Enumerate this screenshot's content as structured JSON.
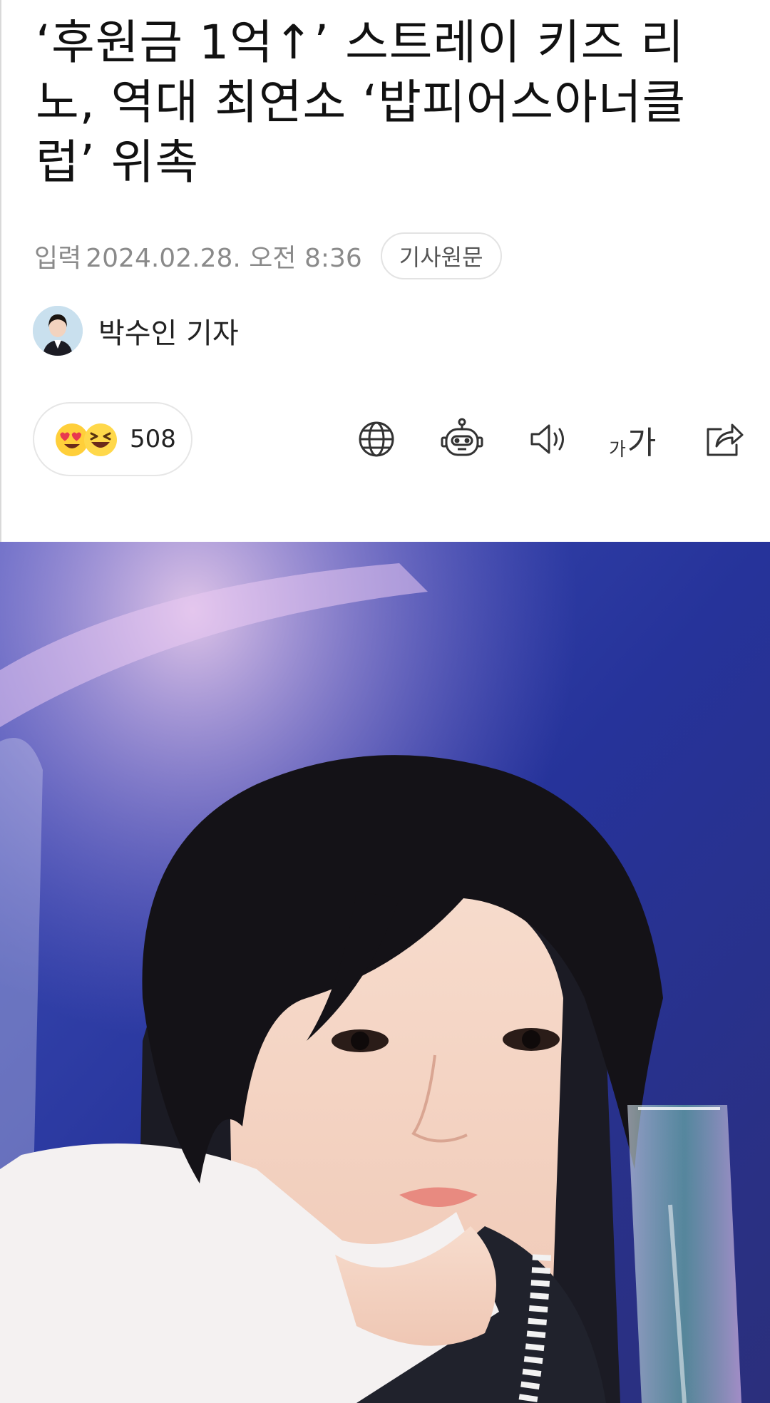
{
  "article": {
    "headline": "‘후원금 1억↑’ 스트레이 키즈 리노, 역대 최연소 ‘밥피어스아너클럽’ 위촉",
    "meta": {
      "input_label": "입력",
      "date": "2024.02.28. 오전 8:36",
      "original_button": "기사원문"
    },
    "author": {
      "name": "박수인 기자"
    },
    "reactions": {
      "count": "508",
      "emojis": [
        "heart-eyes-emoji",
        "grinning-squint-emoji"
      ]
    },
    "toolbar": {
      "icons": [
        "globe-icon",
        "robot-icon",
        "speaker-icon",
        "font-size-icon",
        "share-icon"
      ],
      "font_small": "가",
      "font_big": "가"
    }
  },
  "colors": {
    "text": "#111111",
    "meta": "#8a8a8a",
    "border": "#e3e3e3",
    "emoji_yellow": "#ffd23c",
    "heart_red": "#e8384f",
    "photo_background": "#2b3ea8"
  },
  "hero_image": {
    "type": "photo",
    "subject": "portrait"
  }
}
